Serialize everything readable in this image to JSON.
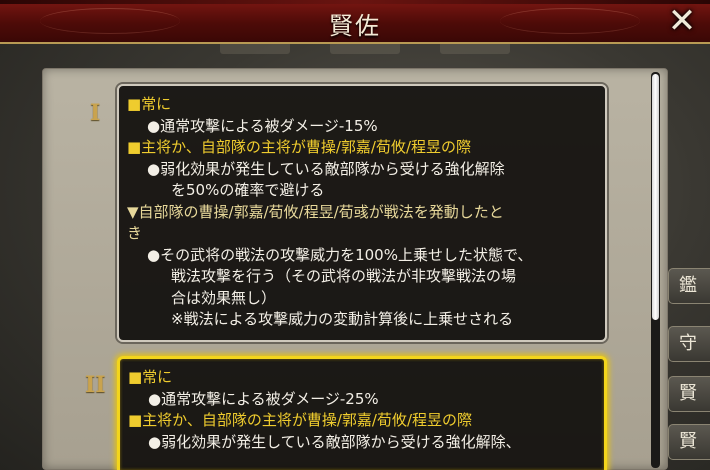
{
  "window": {
    "title": "賢佐",
    "close_label": "✕"
  },
  "side_buttons": [
    "鑑",
    "守",
    "賢",
    "賢"
  ],
  "tiers": [
    {
      "numeral": "I",
      "lines": [
        {
          "kind": "cond",
          "text": "■常に"
        },
        {
          "kind": "bullet",
          "text": "●通常攻撃による被ダメージ-15%"
        },
        {
          "kind": "cond",
          "text": "■主将か、自部隊の主将が曹操/郭嘉/荀攸/程昱の際"
        },
        {
          "kind": "bullet",
          "text": "●弱化効果が発生している敵部隊から受ける強化解除"
        },
        {
          "kind": "cont",
          "text": "を50%の確率で避ける"
        },
        {
          "kind": "tri",
          "text": "▼自部隊の曹操/郭嘉/荀攸/程昱/荀彧が戦法を発動したと"
        },
        {
          "kind": "tri-cont",
          "text": "き"
        },
        {
          "kind": "bullet",
          "text": "●その武将の戦法の攻撃威力を100%上乗せした状態で、"
        },
        {
          "kind": "cont",
          "text": "戦法攻撃を行う（その武将の戦法が非攻撃戦法の場"
        },
        {
          "kind": "cont",
          "text": "合は効果無し）"
        },
        {
          "kind": "cont",
          "text": "※戦法による攻撃威力の変動計算後に上乗せされる"
        }
      ]
    },
    {
      "numeral": "II",
      "lines": [
        {
          "kind": "cond",
          "text": "■常に"
        },
        {
          "kind": "bullet",
          "text": "●通常攻撃による被ダメージ-25%"
        },
        {
          "kind": "cond",
          "text": "■主将か、自部隊の主将が曹操/郭嘉/荀攸/程昱の際"
        },
        {
          "kind": "bullet",
          "text": "●弱化効果が発生している敵部隊から受ける強化解除、"
        }
      ]
    }
  ],
  "colors": {
    "condition": "#efcc2e",
    "trigger": "#e7d89a",
    "body_text": "#f3efe6",
    "selected_border": "#f3d51c",
    "header": "#5e0f0b"
  }
}
